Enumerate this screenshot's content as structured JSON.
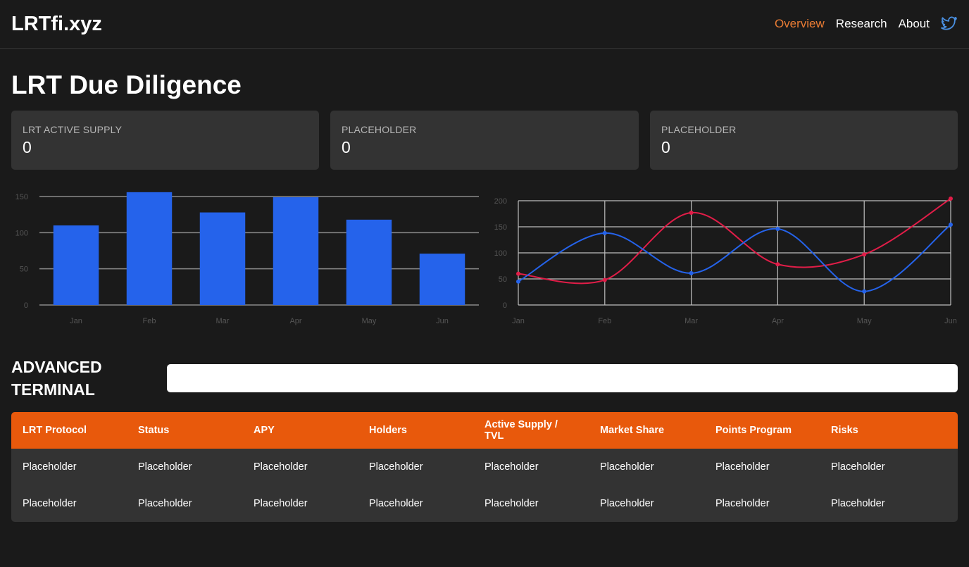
{
  "header": {
    "logo": "LRTfi.xyz",
    "nav": [
      {
        "label": "Overview",
        "active": true
      },
      {
        "label": "Research",
        "active": false
      },
      {
        "label": "About",
        "active": false
      }
    ],
    "social_icon": "twitter-icon",
    "accent_color": "#ea7c34"
  },
  "page_title": "LRT Due Diligence",
  "stats": [
    {
      "label": "LRT ACTIVE SUPPLY",
      "value": "0"
    },
    {
      "label": "PLACEHOLDER",
      "value": "0"
    },
    {
      "label": "PLACEHOLDER",
      "value": "0"
    }
  ],
  "chart_data": [
    {
      "type": "bar",
      "categories": [
        "Jan",
        "Feb",
        "Mar",
        "Apr",
        "May",
        "Jun"
      ],
      "values": [
        110,
        156,
        128,
        149,
        118,
        71
      ],
      "ylim": [
        0,
        150
      ],
      "yticks": [
        0,
        50,
        100,
        150
      ],
      "grid": true,
      "color": "#2563eb"
    },
    {
      "type": "line",
      "categories": [
        "Jan",
        "Feb",
        "Mar",
        "Apr",
        "May",
        "Jun"
      ],
      "ylim": [
        0,
        200
      ],
      "yticks": [
        0,
        50,
        100,
        150,
        200
      ],
      "grid": true,
      "series": [
        {
          "values": [
            60,
            48,
            177,
            78,
            97,
            204
          ],
          "color": "#e11d48"
        },
        {
          "values": [
            45,
            138,
            61,
            146,
            26,
            154
          ],
          "color": "#2563eb"
        }
      ]
    }
  ],
  "terminal": {
    "title": "ADVANCED TERMINAL",
    "search_value": "",
    "header_color": "#e8590c",
    "columns": [
      "LRT Protocol",
      "Status",
      "APY",
      "Holders",
      "Active Supply / TVL",
      "Market Share",
      "Points Program",
      "Risks"
    ],
    "rows": [
      [
        "Placeholder",
        "Placeholder",
        "Placeholder",
        "Placeholder",
        "Placeholder",
        "Placeholder",
        "Placeholder",
        "Placeholder"
      ],
      [
        "Placeholder",
        "Placeholder",
        "Placeholder",
        "Placeholder",
        "Placeholder",
        "Placeholder",
        "Placeholder",
        "Placeholder"
      ]
    ]
  }
}
